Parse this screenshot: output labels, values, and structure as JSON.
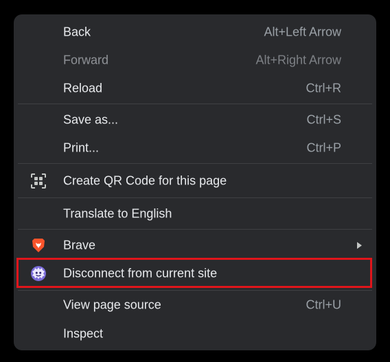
{
  "menu": {
    "items": [
      {
        "label": "Back",
        "shortcut": "Alt+Left Arrow"
      },
      {
        "label": "Forward",
        "shortcut": "Alt+Right Arrow"
      },
      {
        "label": "Reload",
        "shortcut": "Ctrl+R"
      },
      {
        "label": "Save as...",
        "shortcut": "Ctrl+S"
      },
      {
        "label": "Print...",
        "shortcut": "Ctrl+P"
      },
      {
        "label": "Create QR Code for this page",
        "icon": "qr-code-icon"
      },
      {
        "label": "Translate to English"
      },
      {
        "label": "Brave",
        "icon": "brave-lion-icon",
        "submenu": true
      },
      {
        "label": "Disconnect from current site",
        "icon": "disconnect-icon",
        "highlighted": true
      },
      {
        "label": "View page source",
        "shortcut": "Ctrl+U"
      },
      {
        "label": "Inspect"
      }
    ]
  },
  "colors": {
    "menu_background": "#292a2d",
    "text": "#e8eaed",
    "shortcut_text": "#9aa0a6",
    "highlight_border": "#e0151b",
    "brave_orange": "#fb542b",
    "disconnect_purple": "#7b6cd9"
  }
}
